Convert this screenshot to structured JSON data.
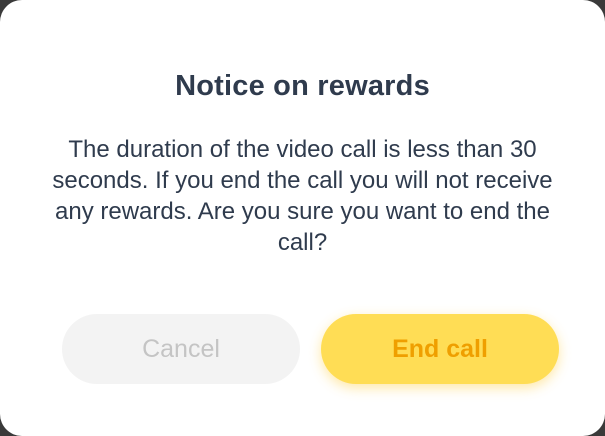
{
  "dialog": {
    "title": "Notice on rewards",
    "message": "The duration of the video call is less than 30 seconds. If you end the call you will not receive any rewards. Are you sure you want to end the call?",
    "cancel_label": "Cancel",
    "end_label": "End call"
  },
  "colors": {
    "title_text": "#2f3b4d",
    "cancel_bg": "#f3f3f3",
    "cancel_text": "#c4c4c4",
    "end_bg": "#ffdd55",
    "end_text": "#ef9f00"
  }
}
